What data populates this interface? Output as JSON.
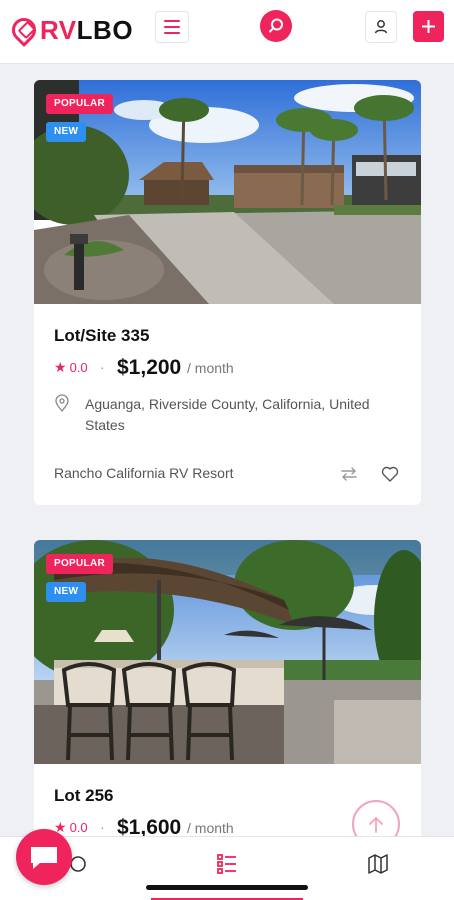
{
  "brand": {
    "rv": "RV",
    "lbo": "LBO"
  },
  "listings": [
    {
      "badge_popular": "POPULAR",
      "badge_new": "NEW",
      "title": "Lot/Site 335",
      "rating": "0.0",
      "separator": "·",
      "price": "$1,200",
      "period": "/ month",
      "location": "Aguanga, Riverside County, California, United States",
      "resort": "Rancho California RV Resort"
    },
    {
      "badge_popular": "POPULAR",
      "badge_new": "NEW",
      "title": "Lot 256",
      "rating": "0.0",
      "separator": "·",
      "price": "$1,600",
      "period": "/ month"
    }
  ],
  "colors": {
    "accent": "#f0245c",
    "new_badge": "#2f8ff0"
  },
  "icons": [
    "menu-icon",
    "search-icon",
    "user-icon",
    "plus-icon",
    "star-icon",
    "location-pin-icon",
    "compare-icon",
    "heart-icon",
    "arrow-up-icon",
    "chat-icon",
    "list-icon",
    "map-icon"
  ]
}
